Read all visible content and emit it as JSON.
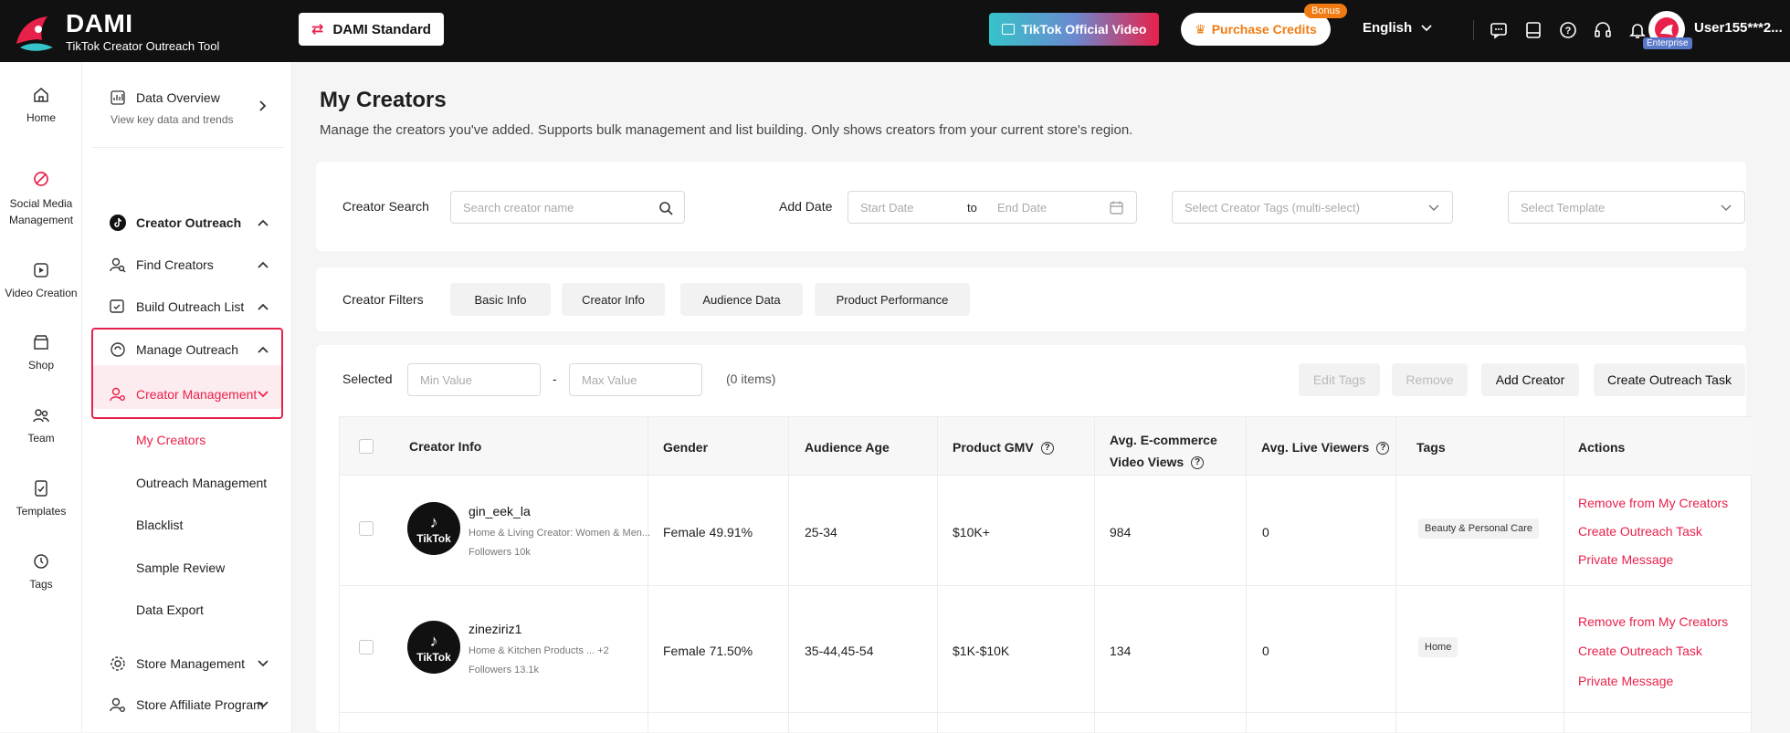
{
  "brand": {
    "name": "DAMI",
    "subtitle": "TikTok Creator Outreach Tool"
  },
  "topbar": {
    "plan_label": "DAMI Standard",
    "tiktok_label": "TikTok Official Video",
    "purchase_label": "Purchase Credits",
    "bonus_badge": "Bonus",
    "language": "English",
    "badge": "Enterprise",
    "username": "User155***2..."
  },
  "nav1": [
    {
      "label": "Home",
      "icon": "home-icon"
    },
    {
      "label": "Social Media Management",
      "icon": "social-icon"
    },
    {
      "label": "Video Creation",
      "icon": "video-icon"
    },
    {
      "label": "Shop",
      "icon": "shop-icon"
    },
    {
      "label": "Team",
      "icon": "team-icon"
    },
    {
      "label": "Templates",
      "icon": "templates-icon"
    },
    {
      "label": "Tags",
      "icon": "tags-icon"
    }
  ],
  "nav2": {
    "data_overview_title": "Data Overview",
    "data_overview_sub": "View key data and trends",
    "creator_outreach": "Creator Outreach",
    "find_creators": "Find Creators",
    "build_list": "Build Outreach List",
    "manage_outreach": "Manage Outreach",
    "creator_management": "Creator Management",
    "my_creators": "My Creators",
    "outreach_management": "Outreach Management",
    "blacklist": "Blacklist",
    "sample_review": "Sample Review",
    "data_export": "Data Export",
    "store_management": "Store Management",
    "store_affiliate": "Store Affiliate Program"
  },
  "page": {
    "title": "My Creators",
    "description": "Manage the creators you've added. Supports bulk management and list building. Only shows creators from your current store's region."
  },
  "search": {
    "creator_search_label": "Creator Search",
    "creator_search_placeholder": "Search creator name",
    "add_date_label": "Add Date",
    "start_date": "Start Date",
    "to": "to",
    "end_date": "End Date",
    "tags_placeholder": "Select Creator Tags (multi-select)",
    "template_placeholder": "Select Template"
  },
  "filters": {
    "label": "Creator Filters",
    "chips": [
      "Basic Info",
      "Creator Info",
      "Audience Data",
      "Product Performance"
    ]
  },
  "selection": {
    "label": "Selected",
    "min_placeholder": "Min Value",
    "dash": "-",
    "max_placeholder": "Max Value",
    "count": "(0 items)",
    "edit_tags": "Edit Tags",
    "remove": "Remove",
    "add_creator": "Add Creator",
    "create_task": "Create Outreach Task"
  },
  "table": {
    "headers": {
      "creator_info": "Creator Info",
      "gender": "Gender",
      "audience_age": "Audience Age",
      "product_gmv": "Product GMV",
      "avg_ecom_views_1": "Avg. E-commerce",
      "avg_ecom_views_2": "Video Views",
      "avg_live_viewers": "Avg. Live Viewers",
      "tags": "Tags",
      "actions": "Actions"
    },
    "rows": [
      {
        "avatar_text": "TikTok",
        "name": "gin_eek_la",
        "category": "Home & Living Creator: Women & Men...",
        "followers": "Followers 10k",
        "gender": "Female 49.91%",
        "age": "25-34",
        "gmv": "$10K+",
        "views": "984",
        "live": "0",
        "tag": "Beauty & Personal Care",
        "actions": [
          "Remove from My Creators",
          "Create Outreach Task",
          "Private Message"
        ]
      },
      {
        "avatar_text": "TikTok",
        "name": "zineziriz1",
        "category": "Home & Kitchen Products ... +2",
        "followers": "Followers 13.1k",
        "gender": "Female 71.50%",
        "age": "35-44,45-54",
        "gmv": "$1K-$10K",
        "views": "134",
        "live": "0",
        "tag": "Home",
        "actions": [
          "Remove from My Creators",
          "Create Outreach Task",
          "Private Message"
        ]
      }
    ]
  },
  "colors": {
    "accent": "#e8214a",
    "orange": "#f07b13",
    "topbar": "#111111"
  }
}
